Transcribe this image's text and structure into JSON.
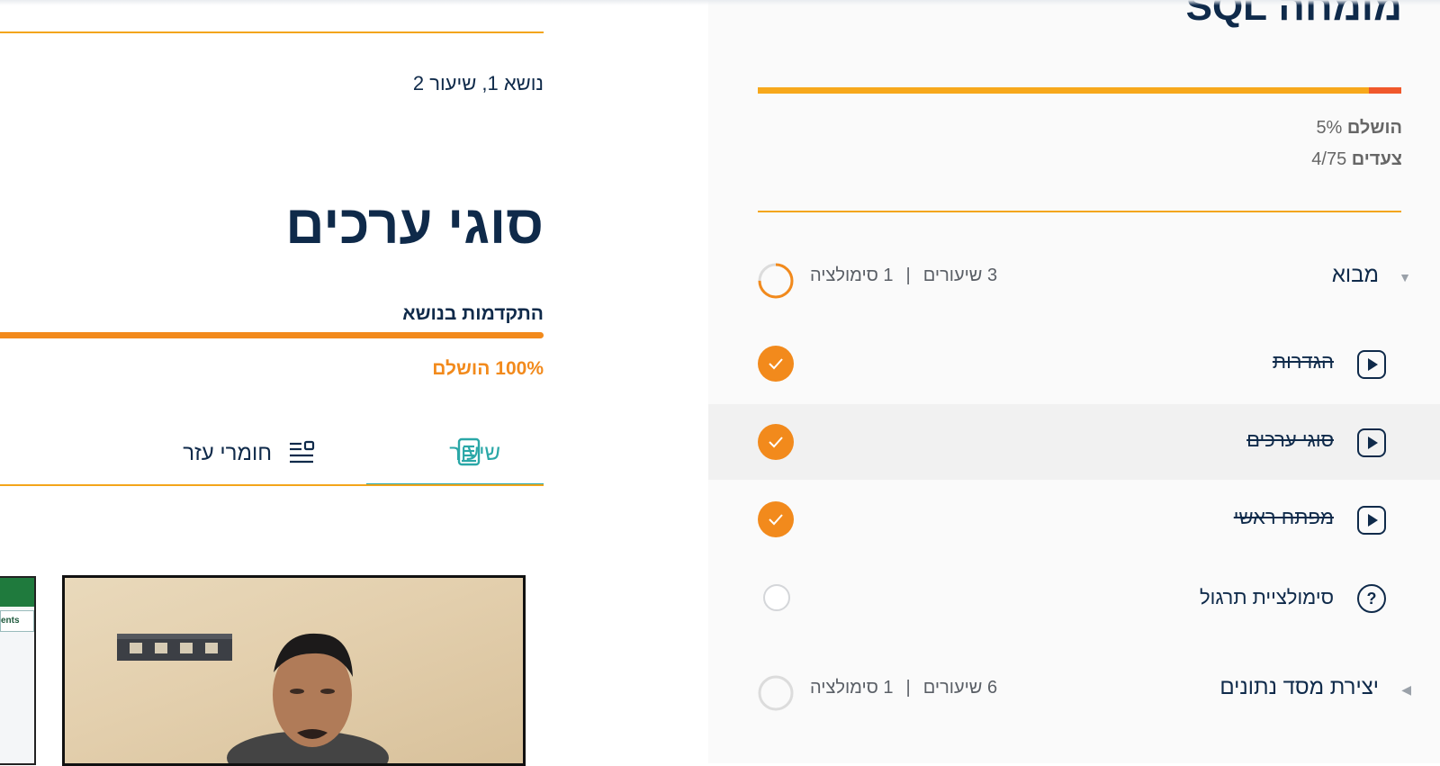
{
  "sidebar": {
    "course_title": "מומחה SQL",
    "course_progress_percent": 5,
    "progress_value": "5%",
    "progress_label": "הושלם",
    "steps_value": "4/75",
    "steps_label": "צעדים",
    "topics": [
      {
        "name": "מבוא",
        "expanded": true,
        "lessons_count": "3 שיעורים",
        "sims_count": "1 סימולציה",
        "separator": "|",
        "completion_fraction": 0.75
      },
      {
        "name": "יצירת מסד נתונים",
        "expanded": false,
        "lessons_count": "6 שיעורים",
        "sims_count": "1 סימולציה",
        "separator": "|",
        "completion_fraction": 0
      }
    ],
    "lessons": [
      {
        "label": "הגדרות",
        "icon": "play-icon",
        "completed": true,
        "active": false
      },
      {
        "label": "סוגי ערכים",
        "icon": "play-icon",
        "completed": true,
        "active": true
      },
      {
        "label": "מפתח ראשי",
        "icon": "play-icon",
        "completed": true,
        "active": false
      },
      {
        "label": "סימולציית תרגול",
        "icon": "question-icon",
        "completed": false,
        "active": false
      }
    ]
  },
  "main": {
    "breadcrumb": "נושא 1, שיעור 2",
    "title": "סוגי ערכים",
    "topic_progress_label": "התקדמות בנושא",
    "topic_progress_percent": 100,
    "topic_progress_text": "100% הושלם",
    "tabs": [
      {
        "label": "שיעור",
        "icon": "book-icon",
        "active": true
      },
      {
        "label": "חומרי עזר",
        "icon": "list-icon",
        "active": false
      }
    ],
    "spreadsheet_snippet": "ents"
  },
  "colors": {
    "navy": "#0f2a4a",
    "orange": "#f28a1c",
    "amber": "#f7a81b",
    "teal": "#2aa7a7"
  }
}
